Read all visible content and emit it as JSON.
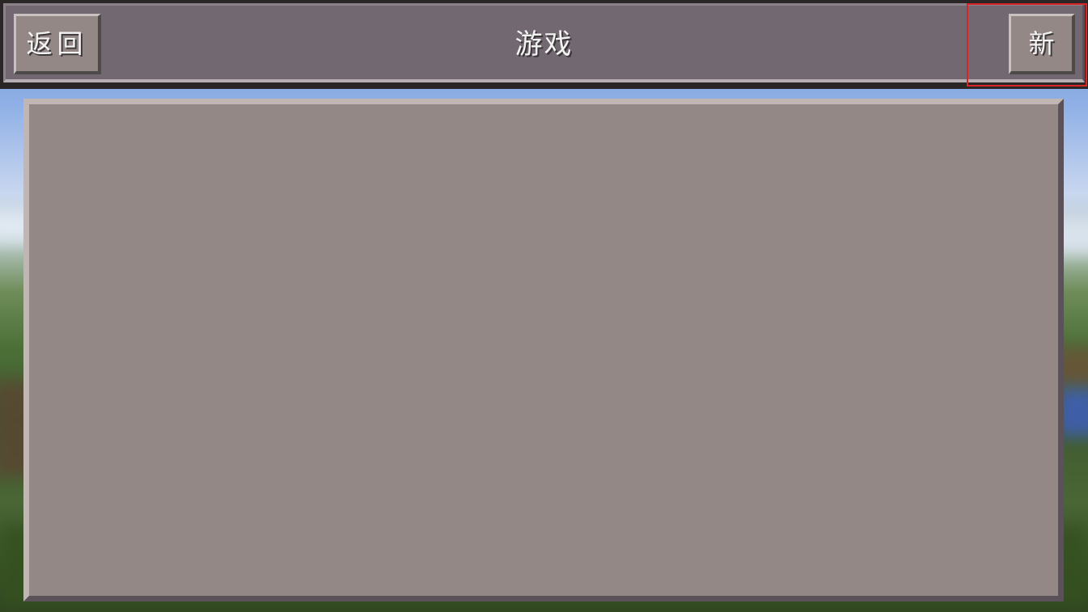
{
  "header": {
    "back_label": "返回",
    "title": "游戏",
    "new_label": "新"
  },
  "icons": {
    "back": "back-button-text",
    "new": "new-world-button-text"
  },
  "colors": {
    "bar": "#726871",
    "button": "#938885",
    "panel": "#938886",
    "highlight": "#d82424"
  },
  "world_list": {
    "items": []
  }
}
